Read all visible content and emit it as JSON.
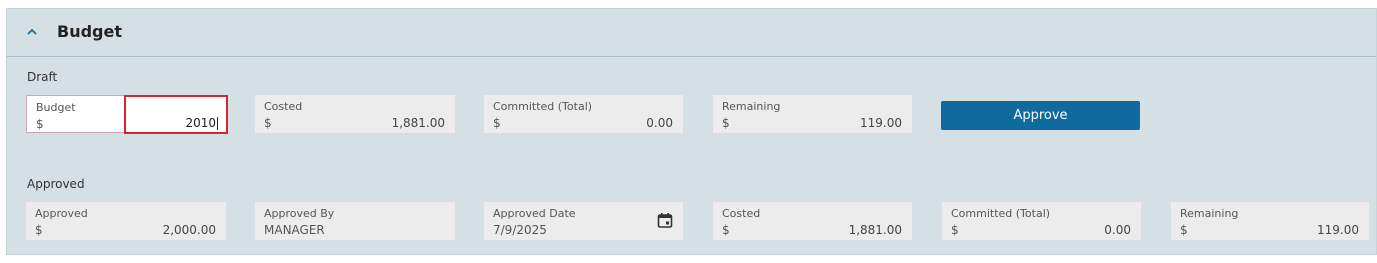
{
  "section": {
    "title": "Budget"
  },
  "draft": {
    "label": "Draft",
    "budget": {
      "label": "Budget",
      "currency": "$",
      "value": "2010"
    },
    "costed": {
      "label": "Costed",
      "currency": "$",
      "value": "1,881.00"
    },
    "committed": {
      "label": "Committed (Total)",
      "currency": "$",
      "value": "0.00"
    },
    "remaining": {
      "label": "Remaining",
      "currency": "$",
      "value": "119.00"
    },
    "approve_button": "Approve"
  },
  "approved": {
    "label": "Approved",
    "approved": {
      "label": "Approved",
      "currency": "$",
      "value": "2,000.00"
    },
    "approved_by": {
      "label": "Approved By",
      "value": "MANAGER"
    },
    "approved_date": {
      "label": "Approved Date",
      "value": "7/9/2025"
    },
    "costed": {
      "label": "Costed",
      "currency": "$",
      "value": "1,881.00"
    },
    "committed": {
      "label": "Committed (Total)",
      "currency": "$",
      "value": "0.00"
    },
    "remaining": {
      "label": "Remaining",
      "currency": "$",
      "value": "119.00"
    }
  },
  "colors": {
    "panel_bg": "#d4e0e4",
    "field_bg": "#ececec",
    "accent": "#0f6aa0",
    "error_border": "#d9242f"
  },
  "icons": {
    "collapse": "chevron-up-icon",
    "date": "calendar-icon"
  }
}
